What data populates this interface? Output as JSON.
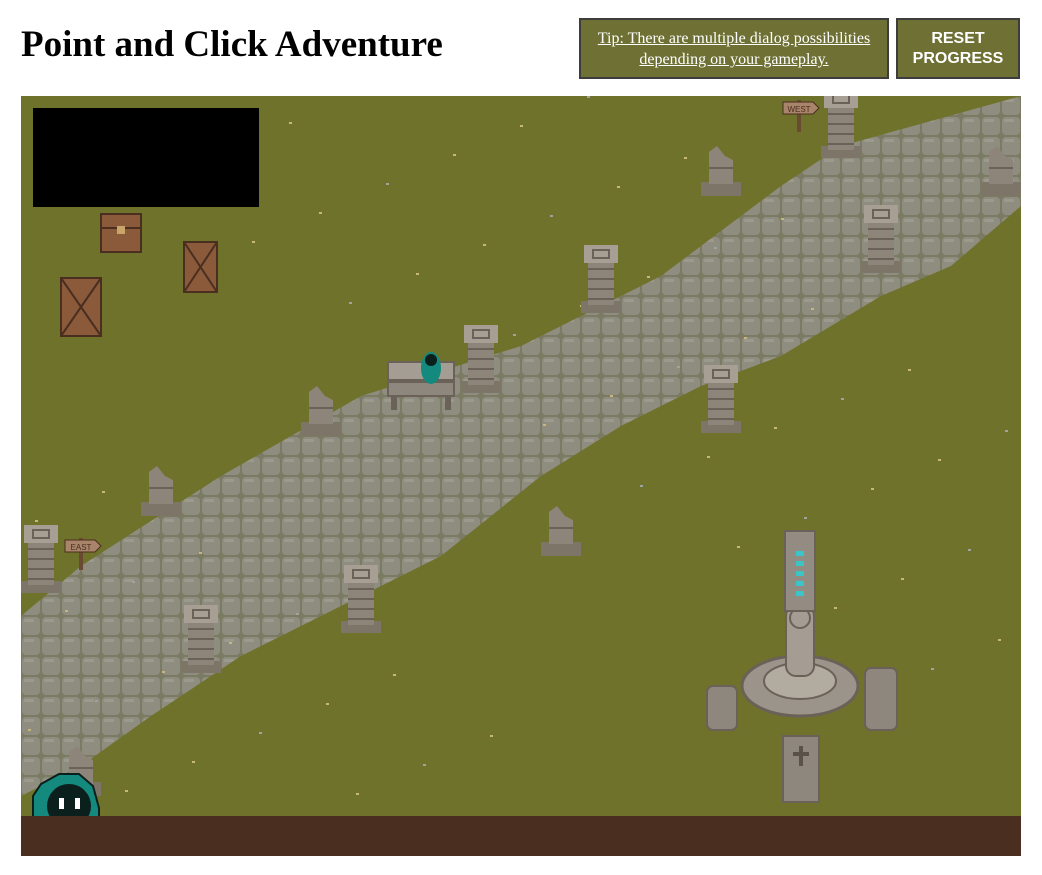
{
  "header": {
    "title": "Point and Click Adventure",
    "tip": "Tip: There are multiple dialog possibilities depending on your gameplay.",
    "reset": "RESET PROGRESS"
  },
  "colors": {
    "grass": "#6f722a",
    "path": "#8e8b7e",
    "ground": "#4a2e1f",
    "button": "#6e7034",
    "player": "#14897d"
  },
  "scene": {
    "signs": [
      "WEST",
      "EAST"
    ],
    "objects": [
      "treasure-chest",
      "wooden-crates",
      "stone-pillars",
      "broken-pillars",
      "bench",
      "goddess-statue-shrine",
      "rune-obelisk",
      "gravestones",
      "coffin"
    ]
  }
}
